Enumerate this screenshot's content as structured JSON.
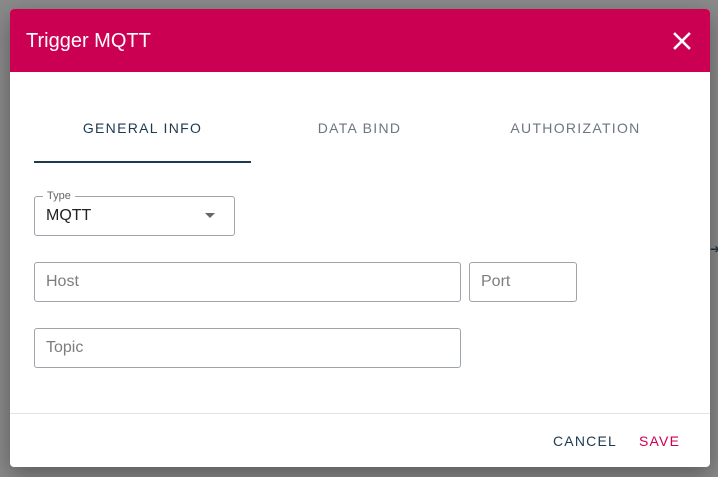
{
  "dialog": {
    "title": "Trigger MQTT",
    "close_icon": "close-icon"
  },
  "tabs": [
    {
      "label": "GENERAL INFO",
      "active": true
    },
    {
      "label": "DATA BIND",
      "active": false
    },
    {
      "label": "AUTHORIZATION",
      "active": false
    }
  ],
  "form": {
    "type": {
      "label": "Type",
      "value": "MQTT"
    },
    "host": {
      "placeholder": "Host",
      "value": ""
    },
    "port": {
      "placeholder": "Port",
      "value": ""
    },
    "topic": {
      "placeholder": "Topic",
      "value": ""
    }
  },
  "footer": {
    "cancel_label": "CANCEL",
    "save_label": "SAVE"
  },
  "colors": {
    "header": "#cc0052",
    "accent": "#1d3a4f",
    "save": "#cc0052"
  }
}
